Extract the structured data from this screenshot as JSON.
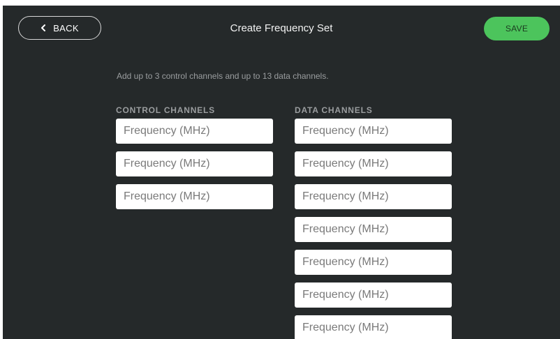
{
  "header": {
    "back_label": "BACK",
    "title": "Create Frequency Set",
    "save_label": "SAVE"
  },
  "instructions": "Add up to 3 control channels and up to 13 data channels.",
  "control_channels": {
    "title": "CONTROL CHANNELS",
    "inputs": [
      {
        "placeholder": "Frequency (MHz)",
        "value": ""
      },
      {
        "placeholder": "Frequency (MHz)",
        "value": ""
      },
      {
        "placeholder": "Frequency (MHz)",
        "value": ""
      }
    ]
  },
  "data_channels": {
    "title": "DATA CHANNELS",
    "inputs": [
      {
        "placeholder": "Frequency (MHz)",
        "value": ""
      },
      {
        "placeholder": "Frequency (MHz)",
        "value": ""
      },
      {
        "placeholder": "Frequency (MHz)",
        "value": ""
      },
      {
        "placeholder": "Frequency (MHz)",
        "value": ""
      },
      {
        "placeholder": "Frequency (MHz)",
        "value": ""
      },
      {
        "placeholder": "Frequency (MHz)",
        "value": ""
      },
      {
        "placeholder": "Frequency (MHz)",
        "value": ""
      }
    ]
  },
  "colors": {
    "background": "#25292a",
    "save_button": "#4cc45c",
    "muted_text": "#9a9d9f"
  },
  "icons": {
    "back": "chevron-left-icon"
  }
}
